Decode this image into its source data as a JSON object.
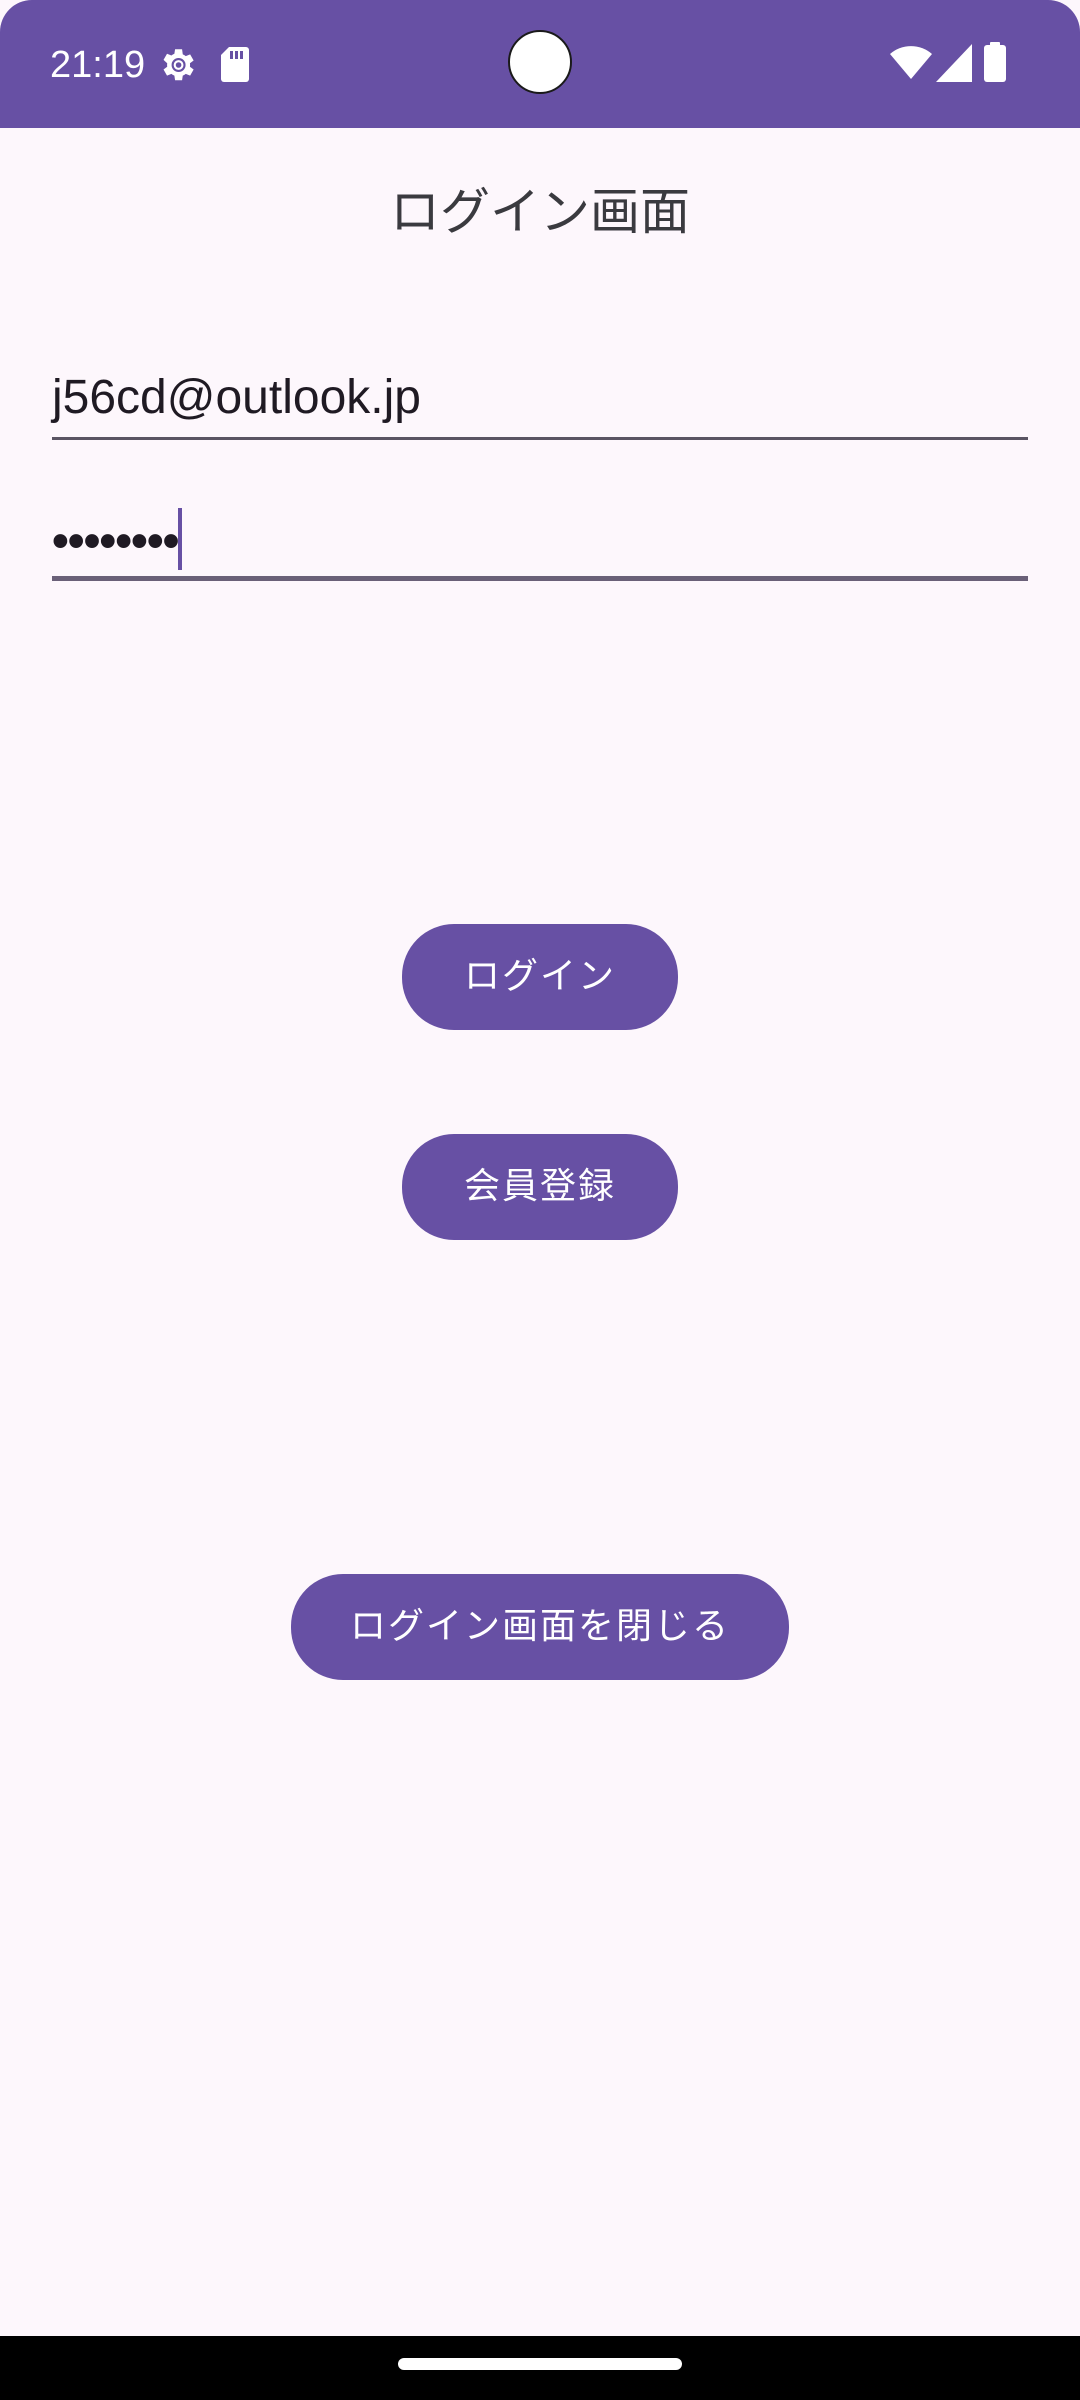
{
  "status_bar": {
    "time": "21:19",
    "left_icons": [
      "settings-gear-icon",
      "sd-card-icon"
    ],
    "right_icons": [
      "wifi-icon",
      "cellular-signal-icon",
      "battery-icon"
    ]
  },
  "page": {
    "title": "ログイン画面"
  },
  "form": {
    "email_value": "j56cd@outlook.jp",
    "password_value": "••••••••"
  },
  "buttons": {
    "login_label": "ログイン",
    "register_label": "会員登録",
    "close_label": "ログイン画面を閉じる"
  },
  "colors": {
    "accent": "#6750A4",
    "background": "#FDF7FC",
    "button_text": "#FFFFFF"
  }
}
